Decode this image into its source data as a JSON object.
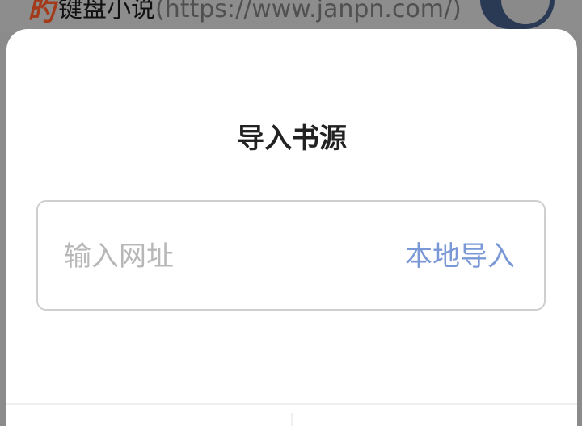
{
  "background_row": {
    "icon": "book-source-icon",
    "title": "键盘小说",
    "url": "(https://www.janpn.com/)",
    "toggle_on": true
  },
  "dialog": {
    "title": "导入书源",
    "url_input": {
      "placeholder": "输入网址",
      "value": ""
    },
    "local_import_label": "本地导入"
  },
  "colors": {
    "accent": "#7a98d6",
    "overlay": "#8b8b8b",
    "dialog_bg": "#ffffff"
  }
}
